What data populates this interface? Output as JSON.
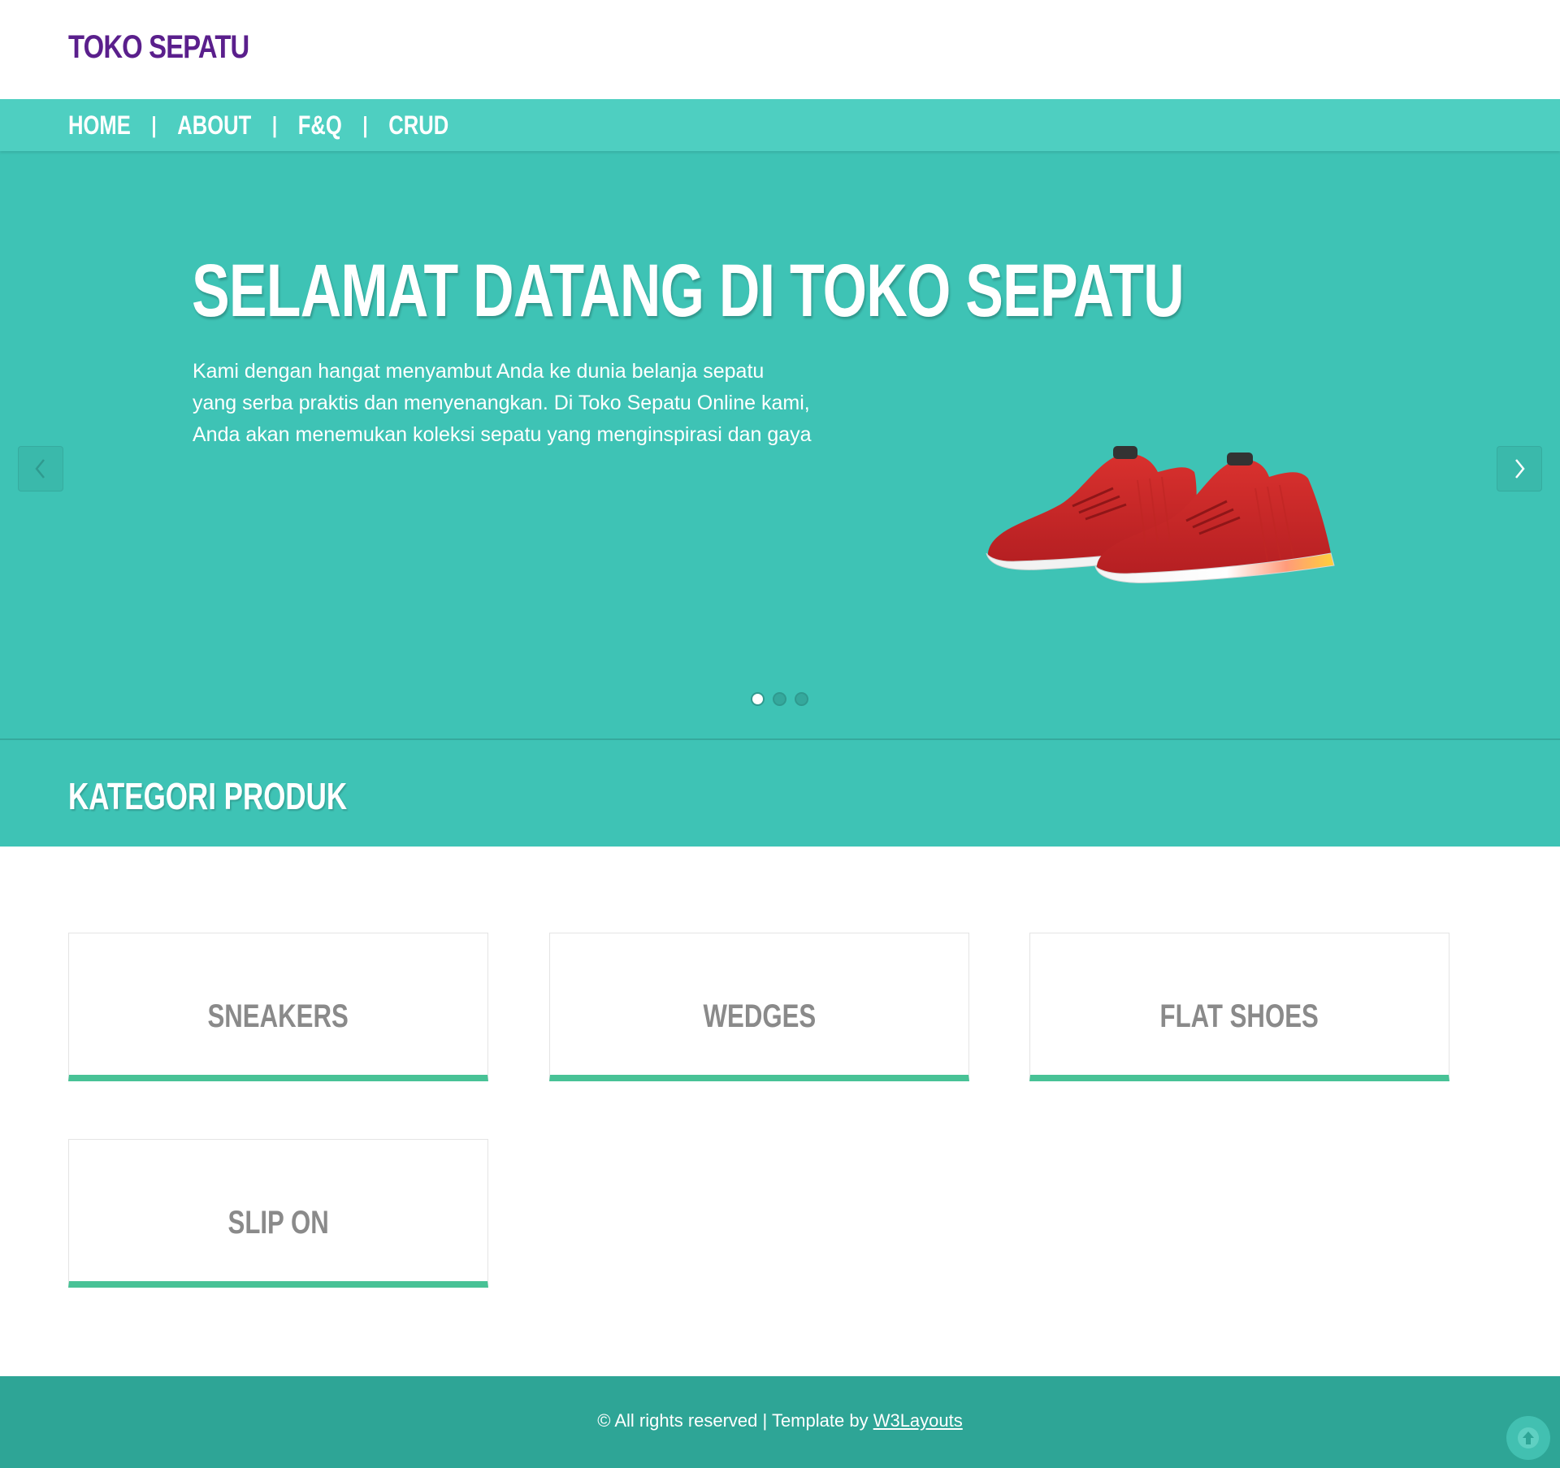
{
  "header": {
    "brand": "TOKO SEPATU"
  },
  "nav": {
    "items": [
      {
        "label": "HOME"
      },
      {
        "label": "ABOUT"
      },
      {
        "label": "F&Q"
      },
      {
        "label": "CRUD"
      }
    ],
    "separator": "|"
  },
  "hero": {
    "title": "SELAMAT DATANG DI TOKO SEPATU",
    "text_lines": [
      "Kami dengan hangat menyambut Anda ke dunia belanja sepatu",
      "yang serba praktis dan menyenangkan. Di Toko Sepatu Online kami,",
      "Anda akan menemukan koleksi sepatu yang menginspirasi dan gaya"
    ],
    "slide_count": 3,
    "active_slide": 1,
    "prev_icon": "chevron-left-icon",
    "next_icon": "chevron-right-icon"
  },
  "categories": {
    "title": "KATEGORI PRODUK",
    "items": [
      {
        "label": "SNEAKERS"
      },
      {
        "label": "WEDGES"
      },
      {
        "label": "FLAT SHOES"
      },
      {
        "label": "SLIP ON"
      }
    ]
  },
  "footer": {
    "text": "© All rights reserved | Template by ",
    "link_label": "W3Layouts"
  },
  "colors": {
    "brand": "#5a1f8c",
    "nav_bg": "#4ecfc1",
    "hero_bg": "#3ec3b5",
    "card_accent": "#48c296",
    "footer_bg": "#2ea596"
  }
}
